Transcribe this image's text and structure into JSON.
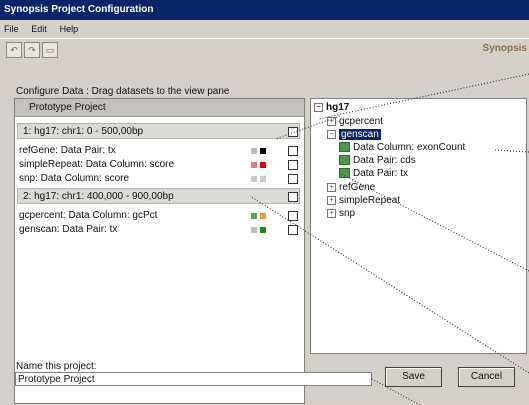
{
  "window": {
    "title": "Synopsis Project Configuration",
    "brand": "Synopsis"
  },
  "menu": [
    "File",
    "Edit",
    "Help"
  ],
  "toolbar": {
    "buttons": [
      "undo-icon",
      "redo-icon",
      "window-icon"
    ]
  },
  "configure_label": "Configure Data : Drag datasets to the view pane",
  "project": {
    "header": "Prototype Project",
    "views": [
      {
        "title": "1: hg17: chr1: 0 - 500,00bp",
        "datasets": [
          {
            "label": "refGene: Data Pair: tx",
            "colors": [
              "#bbbbbb",
              "#000000"
            ]
          },
          {
            "label": "simpleRepeat: Data Column: score",
            "colors": [
              "#d98080",
              "#e00000"
            ]
          },
          {
            "label": "snp: Data Column: score",
            "colors": [
              "#c8c8c8",
              "#c8c8c8"
            ]
          }
        ]
      },
      {
        "title": "2: hg17: chr1: 400,000 - 900,00bp",
        "datasets": [
          {
            "label": "gcpercent: Data Column: gcPct",
            "colors": [
              "#5aa85a",
              "#f0a030"
            ]
          },
          {
            "label": "genscan: Data Pair: tx",
            "colors": [
              "#bbbbbb",
              "#1a8a1a"
            ]
          }
        ]
      }
    ]
  },
  "tree": {
    "root": "hg17",
    "items": [
      {
        "label": "gcpercent",
        "toggle": "+"
      },
      {
        "label": "genscan",
        "toggle": "-",
        "selected": true
      },
      {
        "label": "Data Column: exonCount"
      },
      {
        "label": "Data Pair: cds"
      },
      {
        "label": "Data Pair: tx"
      },
      {
        "label": "refGene",
        "toggle": "+"
      },
      {
        "label": "simpleRepeat",
        "toggle": "+"
      },
      {
        "label": "snp",
        "toggle": "+"
      }
    ]
  },
  "name_field": {
    "label": "Name this project:",
    "value": "Prototype Project"
  },
  "buttons": {
    "save": "Save",
    "cancel": "Cancel"
  }
}
